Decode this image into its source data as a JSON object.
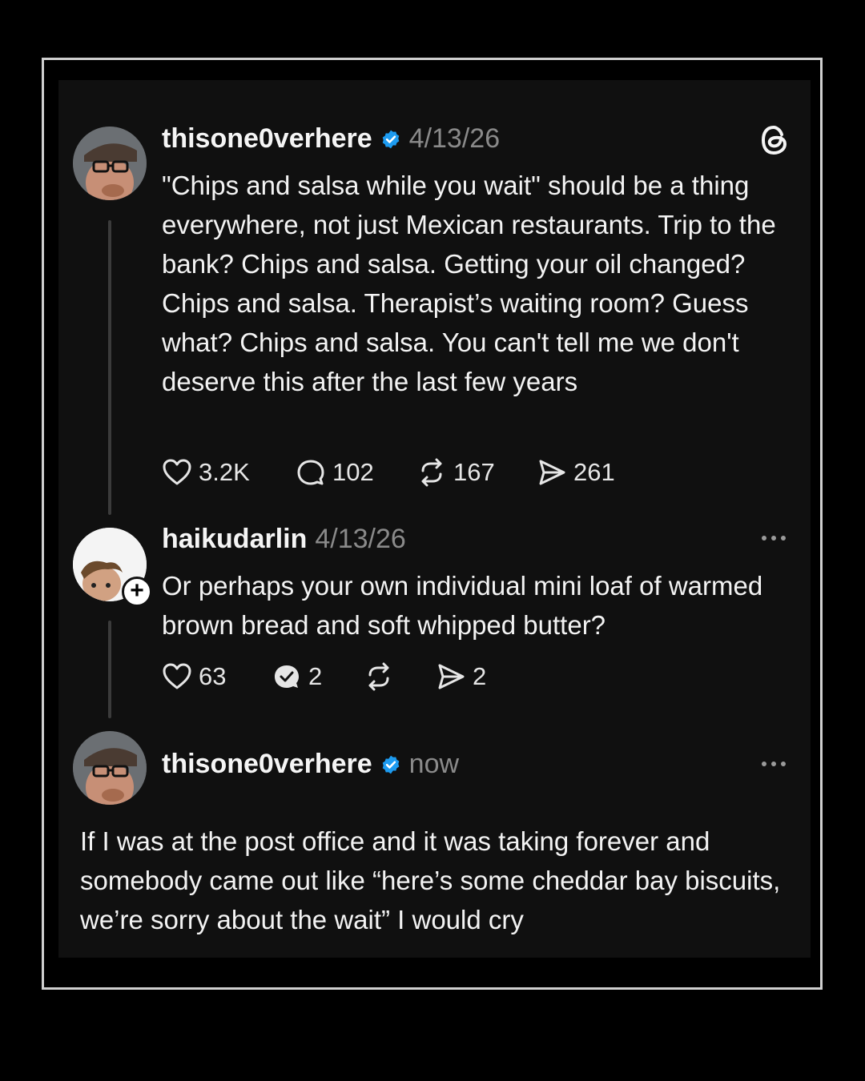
{
  "posts": [
    {
      "username": "thisone0verhere",
      "time": "4/13/26",
      "text": "\"Chips and salsa while you wait\" should be a thing everywhere, not just Mexican restaurants. Trip to the bank? Chips and salsa. Getting your oil changed? Chips and salsa. Therapist’s waiting room? Guess what? Chips and salsa. You can't tell me we don't deserve this after the last few years",
      "likes": "3.2K",
      "replies": "102",
      "reposts": "167",
      "shares": "261"
    },
    {
      "username": "haikudarlin",
      "time": "4/13/26",
      "text": "Or perhaps your own individual mini loaf of warmed brown bread and soft whipped butter?",
      "likes": "63",
      "replies": "2",
      "reposts": "",
      "shares": "2"
    },
    {
      "username": "thisone0verhere",
      "time": "now",
      "text": "If I was at the post office and it was taking forever and somebody came out like “here’s some cheddar bay biscuits, we’re sorry about the wait” I would cry"
    }
  ],
  "icons": {
    "brand": "threads-logo-icon",
    "verified": "verified-badge-icon",
    "like": "heart-icon",
    "reply": "reply-bubble-icon",
    "replied": "replied-check-bubble-icon",
    "repost": "repost-icon",
    "share": "share-send-icon",
    "more": "more-options-icon",
    "follow": "follow-plus-icon"
  },
  "colors": {
    "background": "#000000",
    "card": "#101010",
    "verified": "#1d9bf0",
    "muted": "#8a8a8a",
    "text": "#f3f3f3"
  }
}
